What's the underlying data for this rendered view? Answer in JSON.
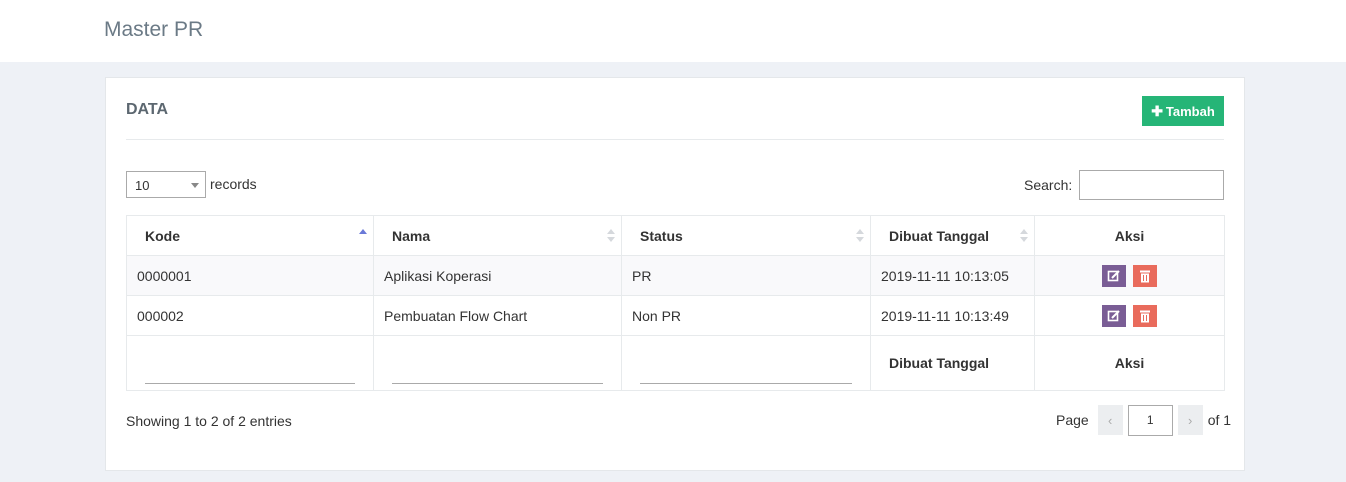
{
  "page": {
    "title": "Master PR"
  },
  "card": {
    "title": "DATA",
    "add_button": {
      "icon": "plus-icon",
      "label": "Tambah",
      "color": "#26b577"
    }
  },
  "length_menu": {
    "value": "10",
    "label": "records"
  },
  "search": {
    "label": "Search:",
    "value": ""
  },
  "table": {
    "headers": [
      "Kode",
      "Nama",
      "Status",
      "Dibuat Tanggal",
      "Aksi"
    ],
    "sorted_column": "Kode",
    "sort_direction": "asc",
    "rows": [
      {
        "kode": "0000001",
        "nama": "Aplikasi Koperasi",
        "status": "PR",
        "dibuat": "2019-11-11 10:13:05"
      },
      {
        "kode": "000002",
        "nama": "Pembuatan Flow Chart",
        "status": "Non PR",
        "dibuat": "2019-11-11 10:13:49"
      }
    ],
    "actions": {
      "edit_icon": "edit-icon",
      "edit_color": "#7a5d95",
      "delete_icon": "trash-icon",
      "delete_color": "#e96b5c"
    },
    "footer": {
      "col4": "Dibuat Tanggal",
      "col5": "Aksi"
    }
  },
  "info": "Showing 1 to 2 of 2 entries",
  "pagination": {
    "label": "Page",
    "prev": "‹",
    "current": "1",
    "next": "›",
    "total_label": "of 1"
  }
}
